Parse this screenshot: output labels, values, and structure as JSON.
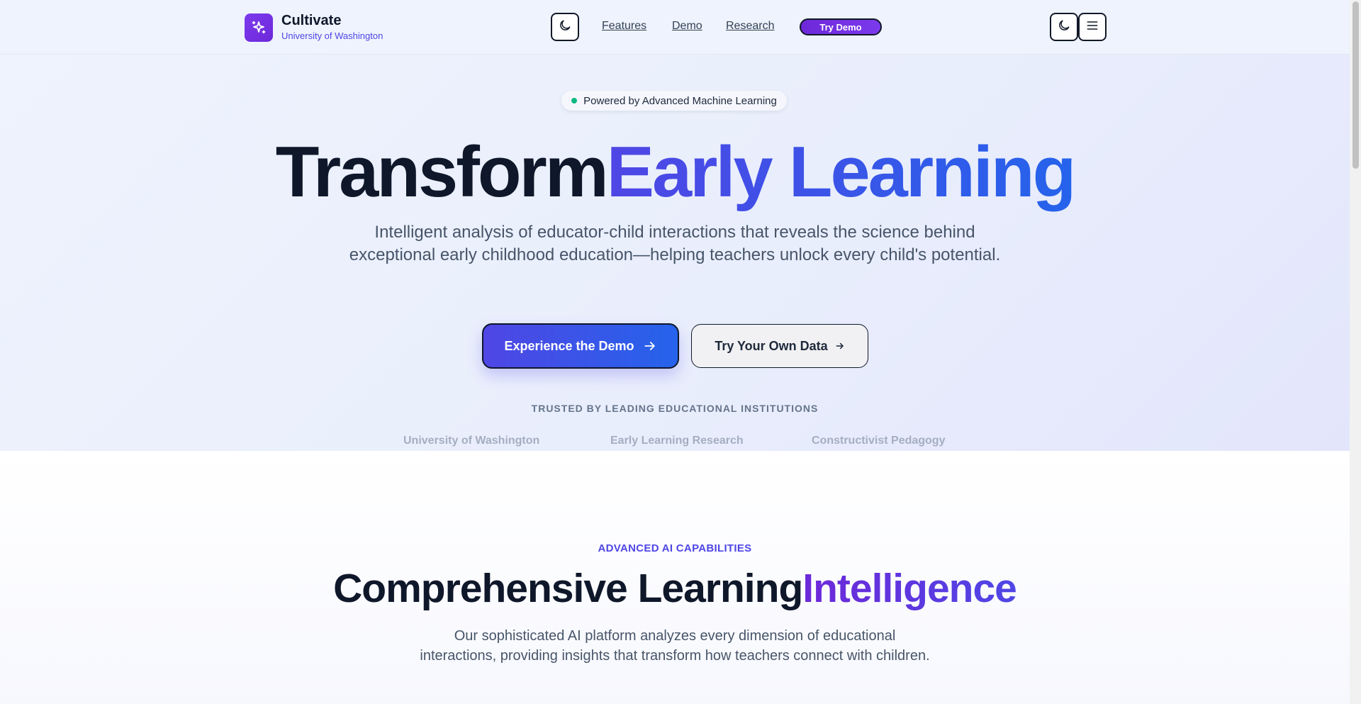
{
  "header": {
    "brand_name": "Cultivate",
    "brand_sub": "University of Washington",
    "nav": [
      "Features",
      "Demo",
      "Research"
    ],
    "cta_label": "Try Demo",
    "icons": {
      "logo": "sparkles-icon",
      "theme": "moon-icon",
      "menu": "hamburger-icon"
    }
  },
  "hero": {
    "badge": "Powered by Advanced Machine Learning",
    "title_dark": "Transform",
    "title_accent": "Early Learning",
    "description": "Intelligent analysis of educator-child interactions that reveals the science behind exceptional early childhood education—helping teachers unlock every child's potential.",
    "primary_button": "Experience the Demo",
    "secondary_button": "Try Your Own Data",
    "trusted_label": "TRUSTED BY LEADING EDUCATIONAL INSTITUTIONS",
    "institutions": [
      "University of Washington",
      "Early Learning Research",
      "Constructivist Pedagogy"
    ]
  },
  "features": {
    "eyebrow": "ADVANCED AI CAPABILITIES",
    "title_dark": "Comprehensive Learning",
    "title_accent": "Intelligence",
    "description": "Our sophisticated AI platform analyzes every dimension of educational interactions, providing insights that transform how teachers connect with children."
  },
  "colors": {
    "accent": "#4f46e5",
    "accent_blue": "#2563eb",
    "brand_purple": "#7c3aed",
    "status_green": "#10b981"
  }
}
